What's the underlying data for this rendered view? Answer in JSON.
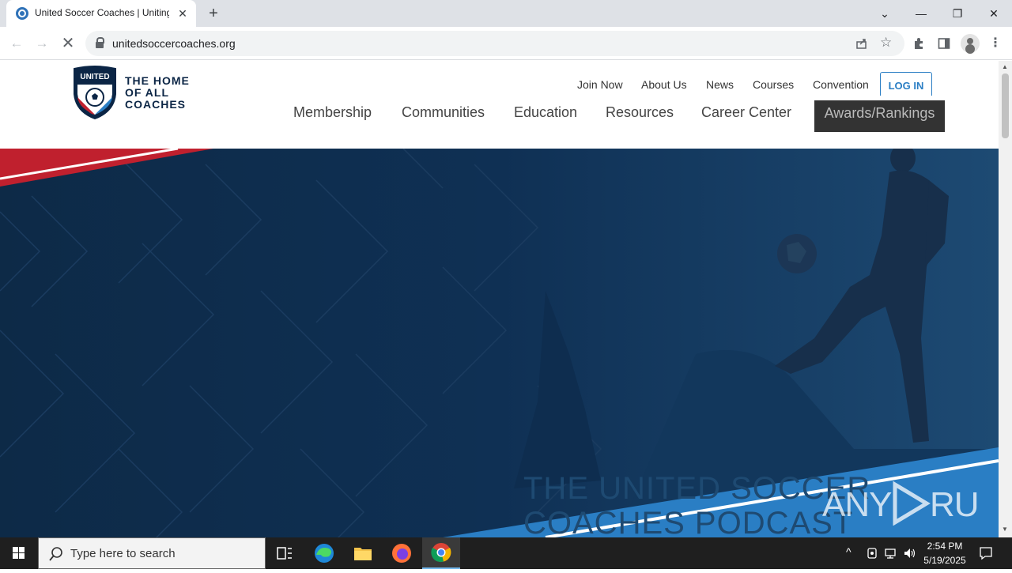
{
  "browser": {
    "tab": {
      "title": "United Soccer Coaches | Uniting",
      "close": "✕"
    },
    "new_tab": "+",
    "window": {
      "minimize": "—",
      "restore": "❐",
      "close": "✕",
      "tabsearch": "⌄"
    },
    "url": "unitedsoccercoaches.org"
  },
  "site": {
    "tagline": [
      "THE HOME",
      "OF ALL",
      "COACHES"
    ],
    "utility_nav": [
      "Join Now",
      "About Us",
      "News",
      "Courses",
      "Convention"
    ],
    "login": "LOG IN",
    "main_nav": [
      "Membership",
      "Communities",
      "Education",
      "Resources",
      "Career Center"
    ],
    "awards": "Awards/Rankings",
    "hero_text": [
      "THE UNITED SOCCER",
      "COACHES PODCAST"
    ],
    "watermark": "ANY RUN"
  },
  "taskbar": {
    "search_placeholder": "Type here to search",
    "time": "2:54 PM",
    "date": "5/19/2025"
  },
  "colors": {
    "navy": "#0d2a47",
    "accent_blue": "#2a7ec4",
    "red": "#c0202e"
  }
}
